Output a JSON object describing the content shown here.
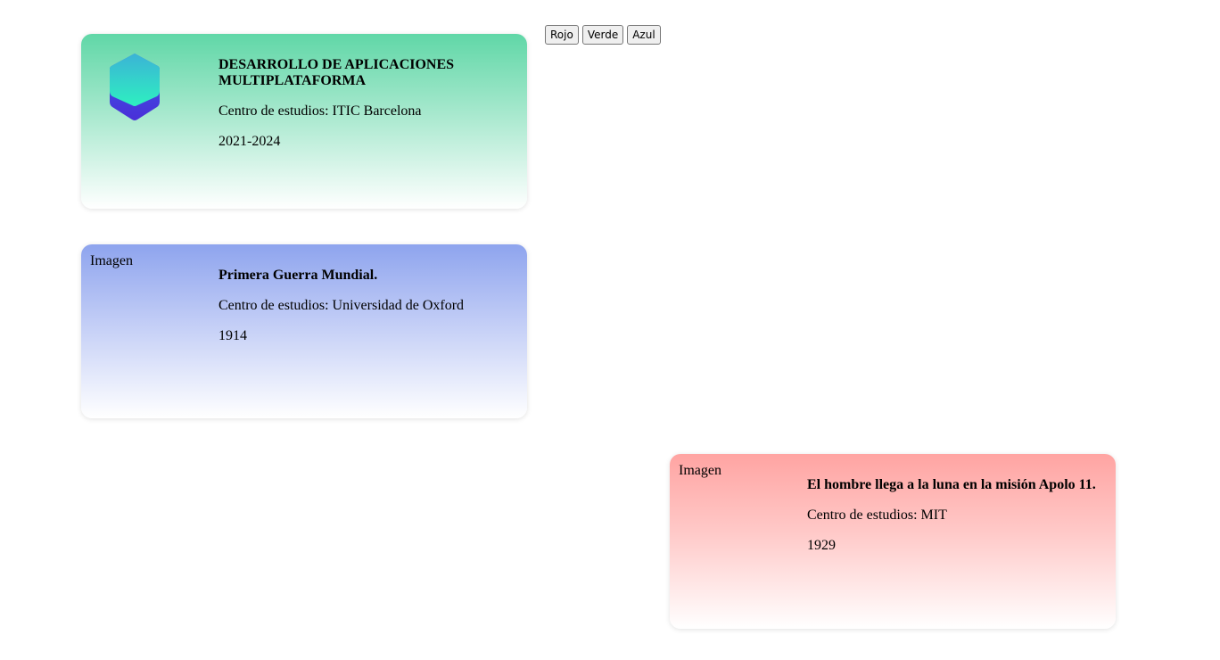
{
  "controls": {
    "buttons": [
      "Rojo",
      "Verde",
      "Azul"
    ]
  },
  "cards": [
    {
      "image_text": "",
      "icon": "hexagon-logo-icon",
      "title": "DESARROLLO DE APLICACIONES MULTIPLATAFORMA",
      "center": "Centro de estudios: ITIC Barcelona",
      "years": "2021-2024",
      "colors": {
        "top": "#60d7a7",
        "bottom": "#ffffff"
      }
    },
    {
      "image_text": "Imagen",
      "title": "Primera Guerra Mundial.",
      "center": "Centro de estudios: Universidad de Oxford",
      "years": "1914",
      "colors": {
        "top": "#8ea4ee",
        "bottom": "#ffffff"
      }
    },
    {
      "image_text": "Imagen",
      "title": "El hombre llega a la luna en la misión Apolo 11.",
      "center": "Centro de estudios: MIT",
      "years": "1929",
      "colors": {
        "top": "#ffa4a2",
        "bottom": "#ffffff"
      }
    }
  ]
}
